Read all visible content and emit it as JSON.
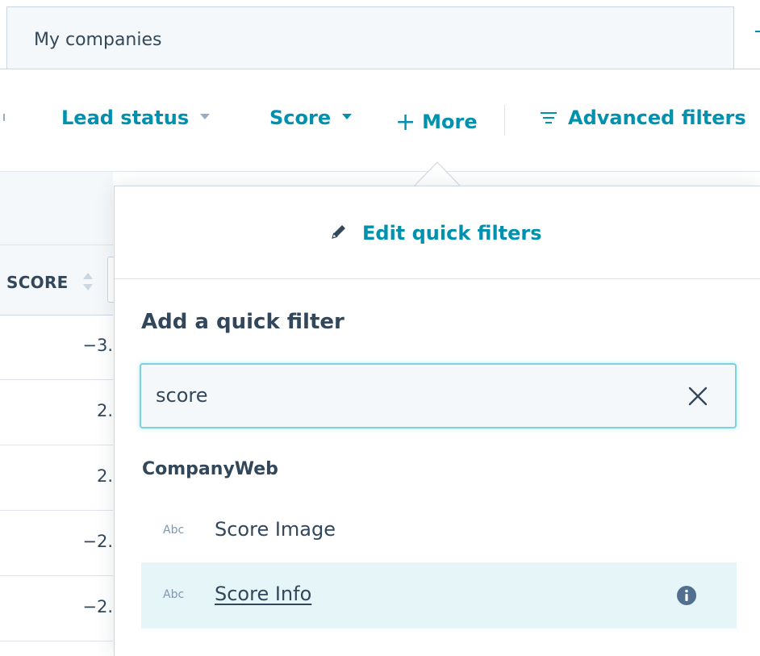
{
  "view_tab": {
    "label": "My companies"
  },
  "filters": {
    "lead_status": "Lead status",
    "score": "Score",
    "more": "More",
    "plus_glyph": "+",
    "advanced": "Advanced filters"
  },
  "table": {
    "column_header": "SCORE",
    "rows": [
      "−3.",
      "2.",
      "2.",
      "−2.",
      "−2."
    ]
  },
  "popover": {
    "edit_link": "Edit quick filters",
    "heading": "Add a quick filter",
    "search_value": "score",
    "group_label": "CompanyWeb",
    "options": [
      {
        "type": "Abc",
        "label": "Score Image"
      },
      {
        "type": "Abc",
        "label": "Score Info"
      }
    ]
  },
  "colors": {
    "accent": "#0091ae",
    "text": "#33475b",
    "border": "#cbd6e2",
    "hover_bg": "#e5f5f8",
    "focus_border": "#7fd1de"
  },
  "icons": [
    "caret-down-icon",
    "plus-icon",
    "filter-lines-icon",
    "sort-icon",
    "pencil-icon",
    "close-icon",
    "info-icon"
  ]
}
